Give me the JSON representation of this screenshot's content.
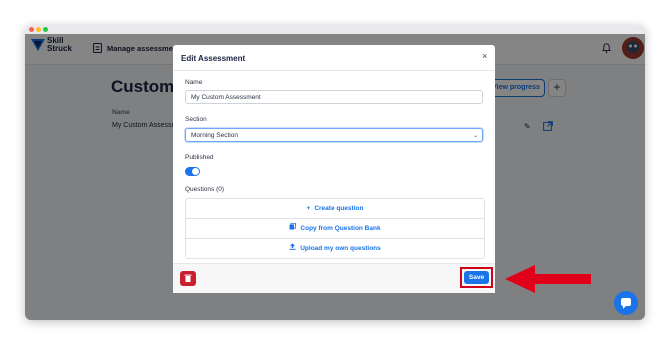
{
  "app": {
    "logo_text_line1": "Skill",
    "logo_text_line2": "Struck",
    "nav_item": "Manage assessments"
  },
  "background_page": {
    "title": "Custom",
    "table_header_name": "Name",
    "row_name": "My Custom Assessme",
    "view_progress_label": "View progress",
    "add_label": "+"
  },
  "modal": {
    "title": "Edit Assessment",
    "close_label": "×",
    "name_label": "Name",
    "name_value": "My Custom Assessment",
    "section_label": "Section",
    "section_value": "Morning Section",
    "published_label": "Published",
    "published": true,
    "questions_label": "Questions (0)",
    "actions": [
      {
        "label": "Create question",
        "icon": "plus-icon"
      },
      {
        "label": "Copy from Question Bank",
        "icon": "copy-icon"
      },
      {
        "label": "Upload my own questions",
        "icon": "upload-icon"
      }
    ],
    "save_label": "Save"
  },
  "colors": {
    "accent": "#1a73e8",
    "danger": "#c8202f",
    "highlight": "#d0021b"
  }
}
